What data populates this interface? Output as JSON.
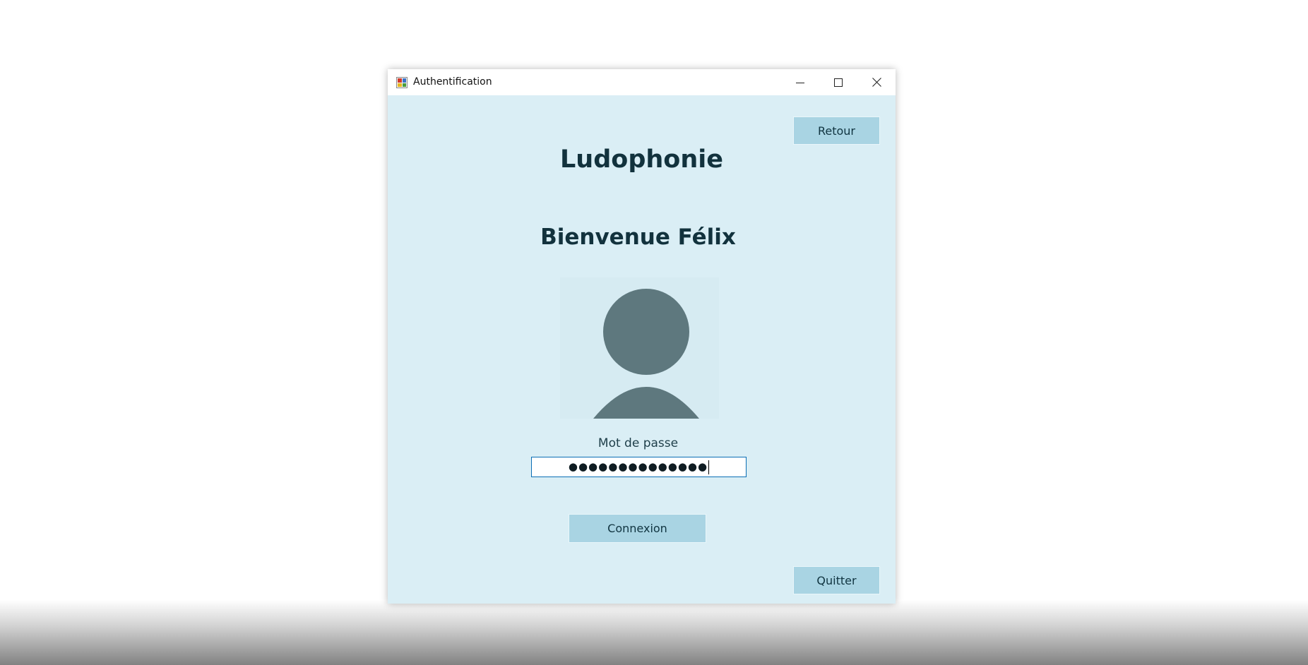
{
  "window": {
    "title": "Authentification"
  },
  "header": {
    "back_label": "Retour",
    "app_name": "Ludophonie",
    "welcome": "Bienvenue Félix"
  },
  "login": {
    "password_label": "Mot de passe",
    "password_value": "●●●●●●●●●●●●●●",
    "submit_label": "Connexion"
  },
  "footer": {
    "quit_label": "Quitter"
  },
  "icons": {
    "app": "app-form-icon",
    "minimize": "minimize-icon",
    "maximize": "maximize-icon",
    "close": "close-icon",
    "avatar": "user-avatar-icon"
  },
  "colors": {
    "window_background": "#daeef5",
    "button_background": "#a9d4e3",
    "avatar": "#5e787e",
    "heading_text": "#12323d",
    "field_focus_border": "#0a6eb5"
  }
}
